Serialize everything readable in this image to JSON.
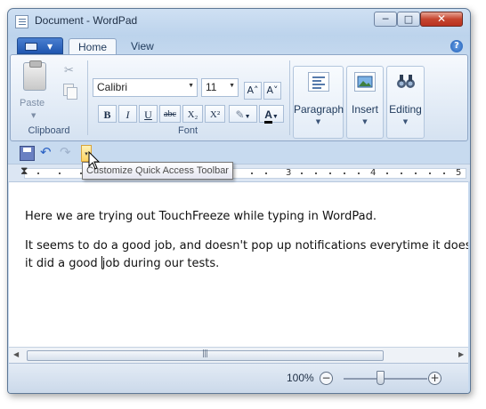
{
  "window": {
    "title": "Document - WordPad",
    "minimize": "─",
    "maximize": "□",
    "close": "✕"
  },
  "tabs": {
    "app_menu_arrow": "▼",
    "home": "Home",
    "view": "View",
    "help": "?"
  },
  "ribbon": {
    "clipboard": {
      "label": "Clipboard",
      "paste": "Paste",
      "cut_icon": "scissors-icon",
      "copy_icon": "copy-icon"
    },
    "font": {
      "label": "Font",
      "family": "Calibri",
      "size": "11",
      "grow": "A˄",
      "shrink": "A˅",
      "bold": "B",
      "italic": "I",
      "underline": "U",
      "strike": "abc",
      "subscript": "X₂",
      "superscript": "X²",
      "highlight_icon": "highlighter-icon",
      "text_color": "A"
    },
    "paragraph": {
      "label": "Paragraph"
    },
    "insert": {
      "label": "Insert"
    },
    "editing": {
      "label": "Editing"
    }
  },
  "quick_access": {
    "save_icon": "save-icon",
    "undo": "↶",
    "redo": "↷",
    "customize": "▾",
    "tooltip": "Customize Quick Access Toolbar"
  },
  "ruler": {
    "numbers": [
      "3",
      "4",
      "5"
    ]
  },
  "document": {
    "line1": "Here we are trying out TouchFreeze while typing in WordPad.",
    "line2": "It seems to do a good job, and doesn't pop up notifications everytime it does it's",
    "line3_before_caret": "it did a good ",
    "line3_after_caret": "job during our tests."
  },
  "scrollbar": {
    "left": "◀",
    "right": "▶",
    "grip": "|||"
  },
  "status": {
    "zoom": "100%",
    "zoom_out": "−",
    "zoom_in": "+",
    "zoom_level": 1.0
  },
  "colors": {
    "accent": "#1f56b0",
    "text_color_bar": "#000000"
  }
}
